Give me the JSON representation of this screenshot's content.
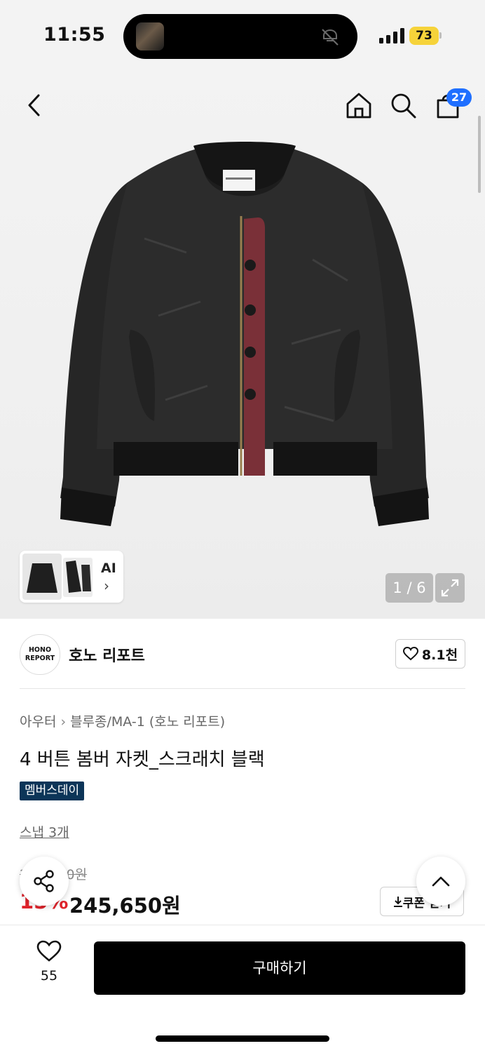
{
  "status_bar": {
    "time": "11:55",
    "battery": "73"
  },
  "header": {
    "cart_count": "27"
  },
  "gallery": {
    "ai_label": "AI",
    "ai_chevron": "›",
    "pager": "1 / 6"
  },
  "brand": {
    "logo_line1": "HONO",
    "logo_line2": "REPORT",
    "name": "호노 리포트",
    "likes": "8.1천"
  },
  "product": {
    "breadcrumb": [
      "아우터",
      "블루종/MA-1 (호노 리포트)"
    ],
    "breadcrumb_sep": "›",
    "title": "4 버튼 봄버 자켓_스크래치 블랙",
    "tag": "멤버스데이",
    "snap": "스냅 3개",
    "original_price": "289,000원",
    "discount": "15%",
    "price": "245,650원",
    "coupon": "쿠폰 받기"
  },
  "bottom": {
    "like_count": "55",
    "buy_label": "구매하기"
  },
  "colors": {
    "accent": "#1f6fff",
    "discount": "#e0242c",
    "tag_bg": "#0c3558",
    "battery": "#f6d33a"
  }
}
